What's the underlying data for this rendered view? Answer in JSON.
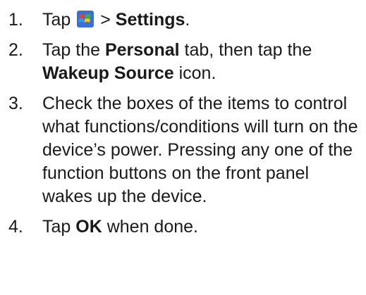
{
  "steps": [
    {
      "num": "1.",
      "pre": "Tap",
      "icon": "windows-start-icon",
      "mid": ">",
      "bold": "Settings",
      "post": "."
    },
    {
      "num": "2.",
      "a": "Tap the",
      "b1": "Personal",
      "c": "tab, then tap the",
      "b2": "Wakeup Source",
      "d": "icon."
    },
    {
      "num": "3.",
      "text": "Check the boxes of the items to control what functions/conditions will turn on the device’s power. Pressing any one of the function buttons on the front panel wakes up the device."
    },
    {
      "num": "4.",
      "pre": "Tap",
      "bold": "OK",
      "post": "when done."
    }
  ],
  "colors": {
    "text": "#1a1a1a",
    "icon_red": "#e8402a",
    "icon_green": "#3cb043",
    "icon_blue": "#2a6fd6",
    "icon_yellow": "#f4c21c",
    "icon_bg": "#3a6fd8"
  }
}
